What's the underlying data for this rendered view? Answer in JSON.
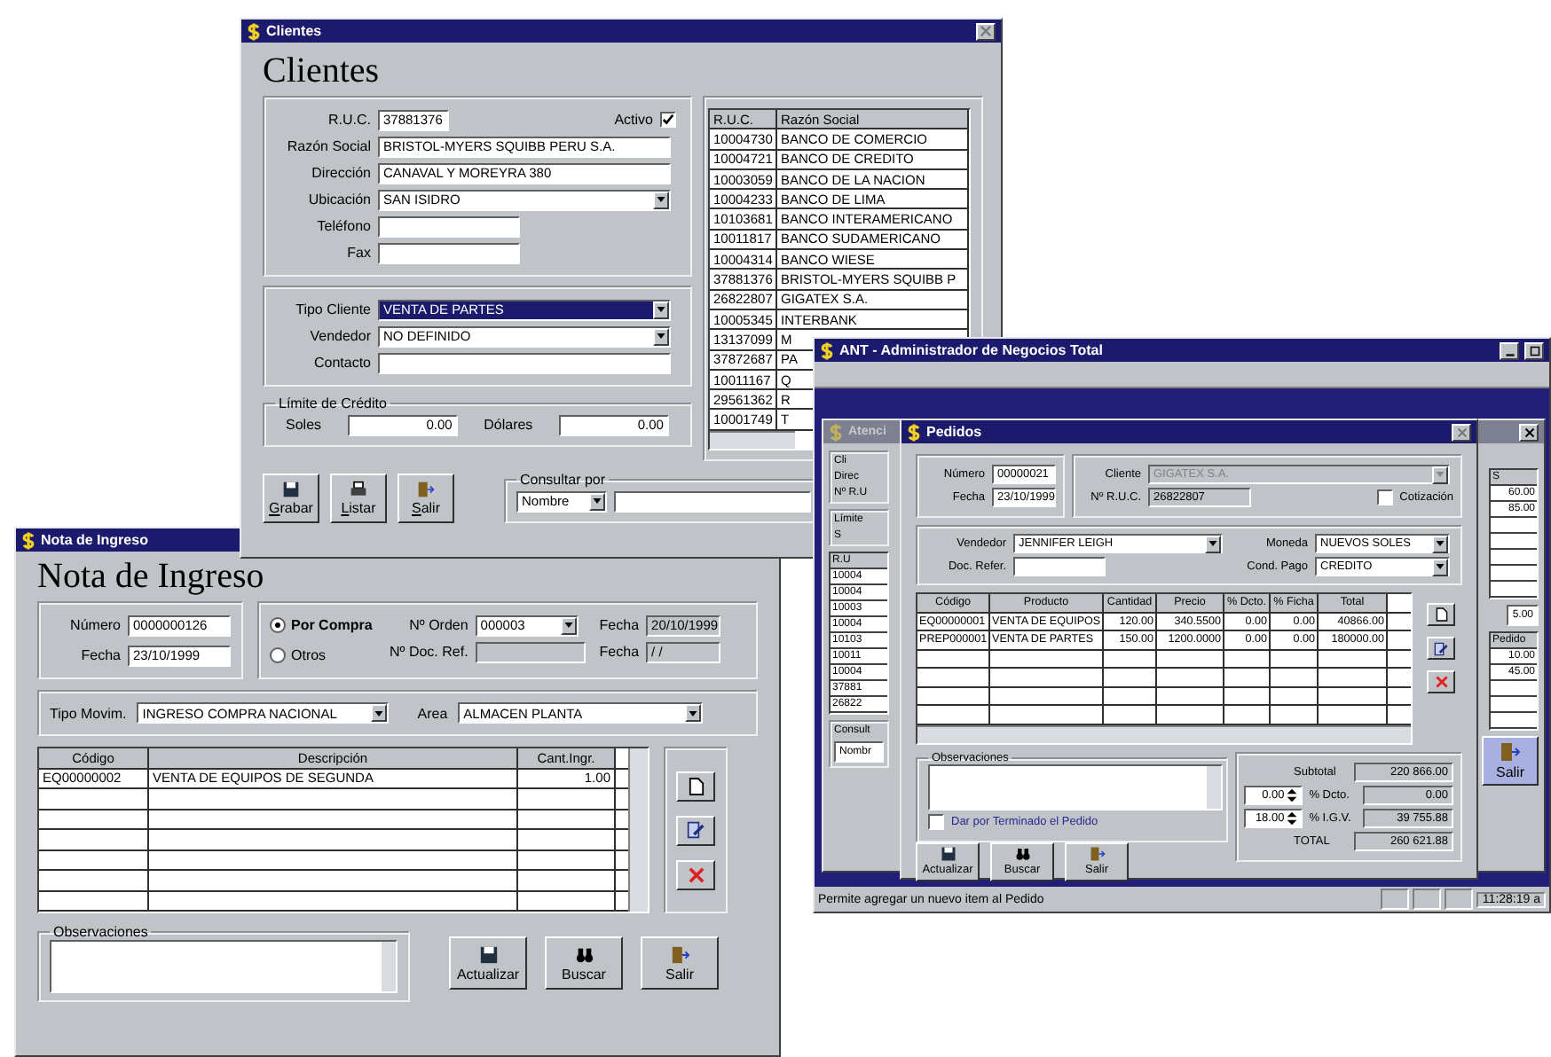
{
  "clientes": {
    "title": "Clientes",
    "heading": "Clientes",
    "ruc": {
      "label": "R.U.C.",
      "value": "37881376"
    },
    "activo": {
      "label": "Activo",
      "checked": true
    },
    "fields": [
      {
        "label": "Razón Social",
        "value": "BRISTOL-MYERS SQUIBB PERU S.A.",
        "kind": "text"
      },
      {
        "label": "Dirección",
        "value": "CANAVAL Y MOREYRA 380",
        "kind": "text"
      },
      {
        "label": "Ubicación",
        "value": "SAN ISIDRO",
        "kind": "combo"
      },
      {
        "label": "Teléfono",
        "kind": "short"
      },
      {
        "label": "Fax",
        "kind": "short"
      }
    ],
    "fields2": [
      {
        "label": "Tipo Cliente",
        "value": "VENTA DE PARTES",
        "kind": "combo",
        "selected": true
      },
      {
        "label": "Vendedor",
        "value": "NO DEFINIDO",
        "kind": "combo",
        "selected": false
      },
      {
        "label": "Contacto",
        "kind": "text",
        "selected": false
      }
    ],
    "credit": {
      "legend": "Límite de Crédito",
      "items": [
        {
          "label": "Soles",
          "value": "0.00"
        },
        {
          "label": "Dólares",
          "value": "0.00"
        }
      ]
    },
    "buttons": [
      {
        "label": "Grabar",
        "kind": "save"
      },
      {
        "label": "Listar",
        "kind": "print"
      },
      {
        "label": "Salir",
        "kind": "exit"
      }
    ],
    "consult": {
      "legend": "Consultar por",
      "value": "Nombre"
    },
    "list": {
      "columns": [
        "R.U.C.",
        "Razón Social"
      ],
      "rows": [
        [
          "10004730",
          "BANCO DE COMERCIO"
        ],
        [
          "10004721",
          "BANCO DE CREDITO"
        ],
        [
          "10003059",
          "BANCO DE LA NACION"
        ],
        [
          "10004233",
          "BANCO DE LIMA"
        ],
        [
          "10103681",
          "BANCO INTERAMERICANO"
        ],
        [
          "10011817",
          "BANCO SUDAMERICANO"
        ],
        [
          "10004314",
          "BANCO WIESE"
        ],
        [
          "37881376",
          "BRISTOL-MYERS SQUIBB P"
        ],
        [
          "26822807",
          "GIGATEX S.A."
        ],
        [
          "10005345",
          "INTERBANK"
        ],
        [
          "13137099",
          "M"
        ],
        [
          "37872687",
          "PA"
        ],
        [
          "10011167",
          "Q"
        ],
        [
          "29561362",
          "R"
        ],
        [
          "10001749",
          "T"
        ]
      ]
    }
  },
  "nota": {
    "title": "Nota de Ingreso",
    "heading": "Nota de Ingreso",
    "numero": {
      "label": "Número",
      "value": "0000000126"
    },
    "fecha": {
      "label": "Fecha",
      "value": "23/10/1999"
    },
    "radios": [
      {
        "label": "Por Compra",
        "selected": true
      },
      {
        "label": "Otros",
        "selected": false
      }
    ],
    "orden": {
      "label": "Nº Orden",
      "value": "000003"
    },
    "docref": {
      "label": "Nº Doc. Ref."
    },
    "fecha1": {
      "label": "Fecha",
      "value": "20/10/1999"
    },
    "fecha2": {
      "label": "Fecha",
      "value": "/ /"
    },
    "tipo": {
      "label": "Tipo Movim.",
      "value": "INGRESO COMPRA NACIONAL"
    },
    "area": {
      "label": "Area",
      "value": "ALMACEN PLANTA"
    },
    "grid": {
      "columns": [
        "Código",
        "Descripción",
        "Cant.Ingr."
      ],
      "rows": [
        [
          "EQ00000002",
          "VENTA DE EQUIPOS DE SEGUNDA",
          "1.00"
        ]
      ]
    },
    "obs": "Observaciones",
    "buttons": [
      {
        "label": "Actualizar",
        "kind": "save"
      },
      {
        "label": "Buscar",
        "kind": "search"
      },
      {
        "label": "Salir",
        "kind": "exit"
      }
    ]
  },
  "ant": {
    "title": "ANT - Administrador de Negocios Total",
    "status": "Permite agregar un nuevo item al Pedido",
    "time": "11:28:19 a",
    "atencion": {
      "title": "Atenci",
      "labels": [
        "Cli",
        "Direc",
        "Nº R.U"
      ],
      "legend": "Límite",
      "credit_label": "S",
      "list_header": "R.U",
      "ids": [
        "10004",
        "10004",
        "10003",
        "10004",
        "10103",
        "10011",
        "10004",
        "37881",
        "26822"
      ],
      "consult": "Consult",
      "consult_value": "Nombr",
      "right_header": "S",
      "right_values": [
        "60.00",
        "85.00"
      ],
      "right_total": "5.00",
      "right_header2": "Pedido",
      "right_values2": [
        "10.00",
        "45.00"
      ],
      "button": "Salir"
    },
    "pedidos": {
      "title": "Pedidos",
      "numero": {
        "label": "Número",
        "value": "00000021"
      },
      "fecha": {
        "label": "Fecha",
        "value": "23/10/1999"
      },
      "cliente": {
        "label": "Cliente",
        "value": "GIGATEX S.A.",
        "disabled": true
      },
      "ruc": {
        "label": "Nº R.U.C.",
        "value": "26822807"
      },
      "cotizacion": {
        "label": "Cotización",
        "checked": false
      },
      "vendedor": {
        "label": "Vendedor",
        "value": "JENNIFER LEIGH"
      },
      "docref": {
        "label": "Doc. Refer."
      },
      "moneda": {
        "label": "Moneda",
        "value": "NUEVOS SOLES"
      },
      "pago": {
        "label": "Cond. Pago",
        "value": "CREDITO"
      },
      "grid": {
        "columns": [
          "Código",
          "Producto",
          "Cantidad",
          "Precio",
          "% Dcto.",
          "% Ficha",
          "Total"
        ],
        "rows": [
          [
            "EQ00000001",
            "VENTA DE EQUIPOS",
            "120.00",
            "340.5500",
            "0.00",
            "0.00",
            "40866.00"
          ],
          [
            "PREP000001",
            "VENTA DE PARTES",
            "150.00",
            "1200.0000",
            "0.00",
            "0.00",
            "180000.00"
          ]
        ]
      },
      "obs": "Observaciones",
      "terminado": {
        "label": "Dar por Terminado el Pedido",
        "checked": false
      },
      "totals": [
        {
          "label": "Subtotal",
          "value": "220 866.00"
        },
        {
          "label": "% Dcto.",
          "input": "0.00",
          "value": "0.00"
        },
        {
          "label": "% I.G.V.",
          "input": "18.00",
          "value": "39 755.88"
        },
        {
          "label": "TOTAL",
          "value": "260 621.88"
        }
      ],
      "buttons": [
        {
          "label": "Actualizar",
          "kind": "save"
        },
        {
          "label": "Buscar",
          "kind": "search"
        },
        {
          "label": "Salir",
          "kind": "exit"
        }
      ]
    }
  }
}
